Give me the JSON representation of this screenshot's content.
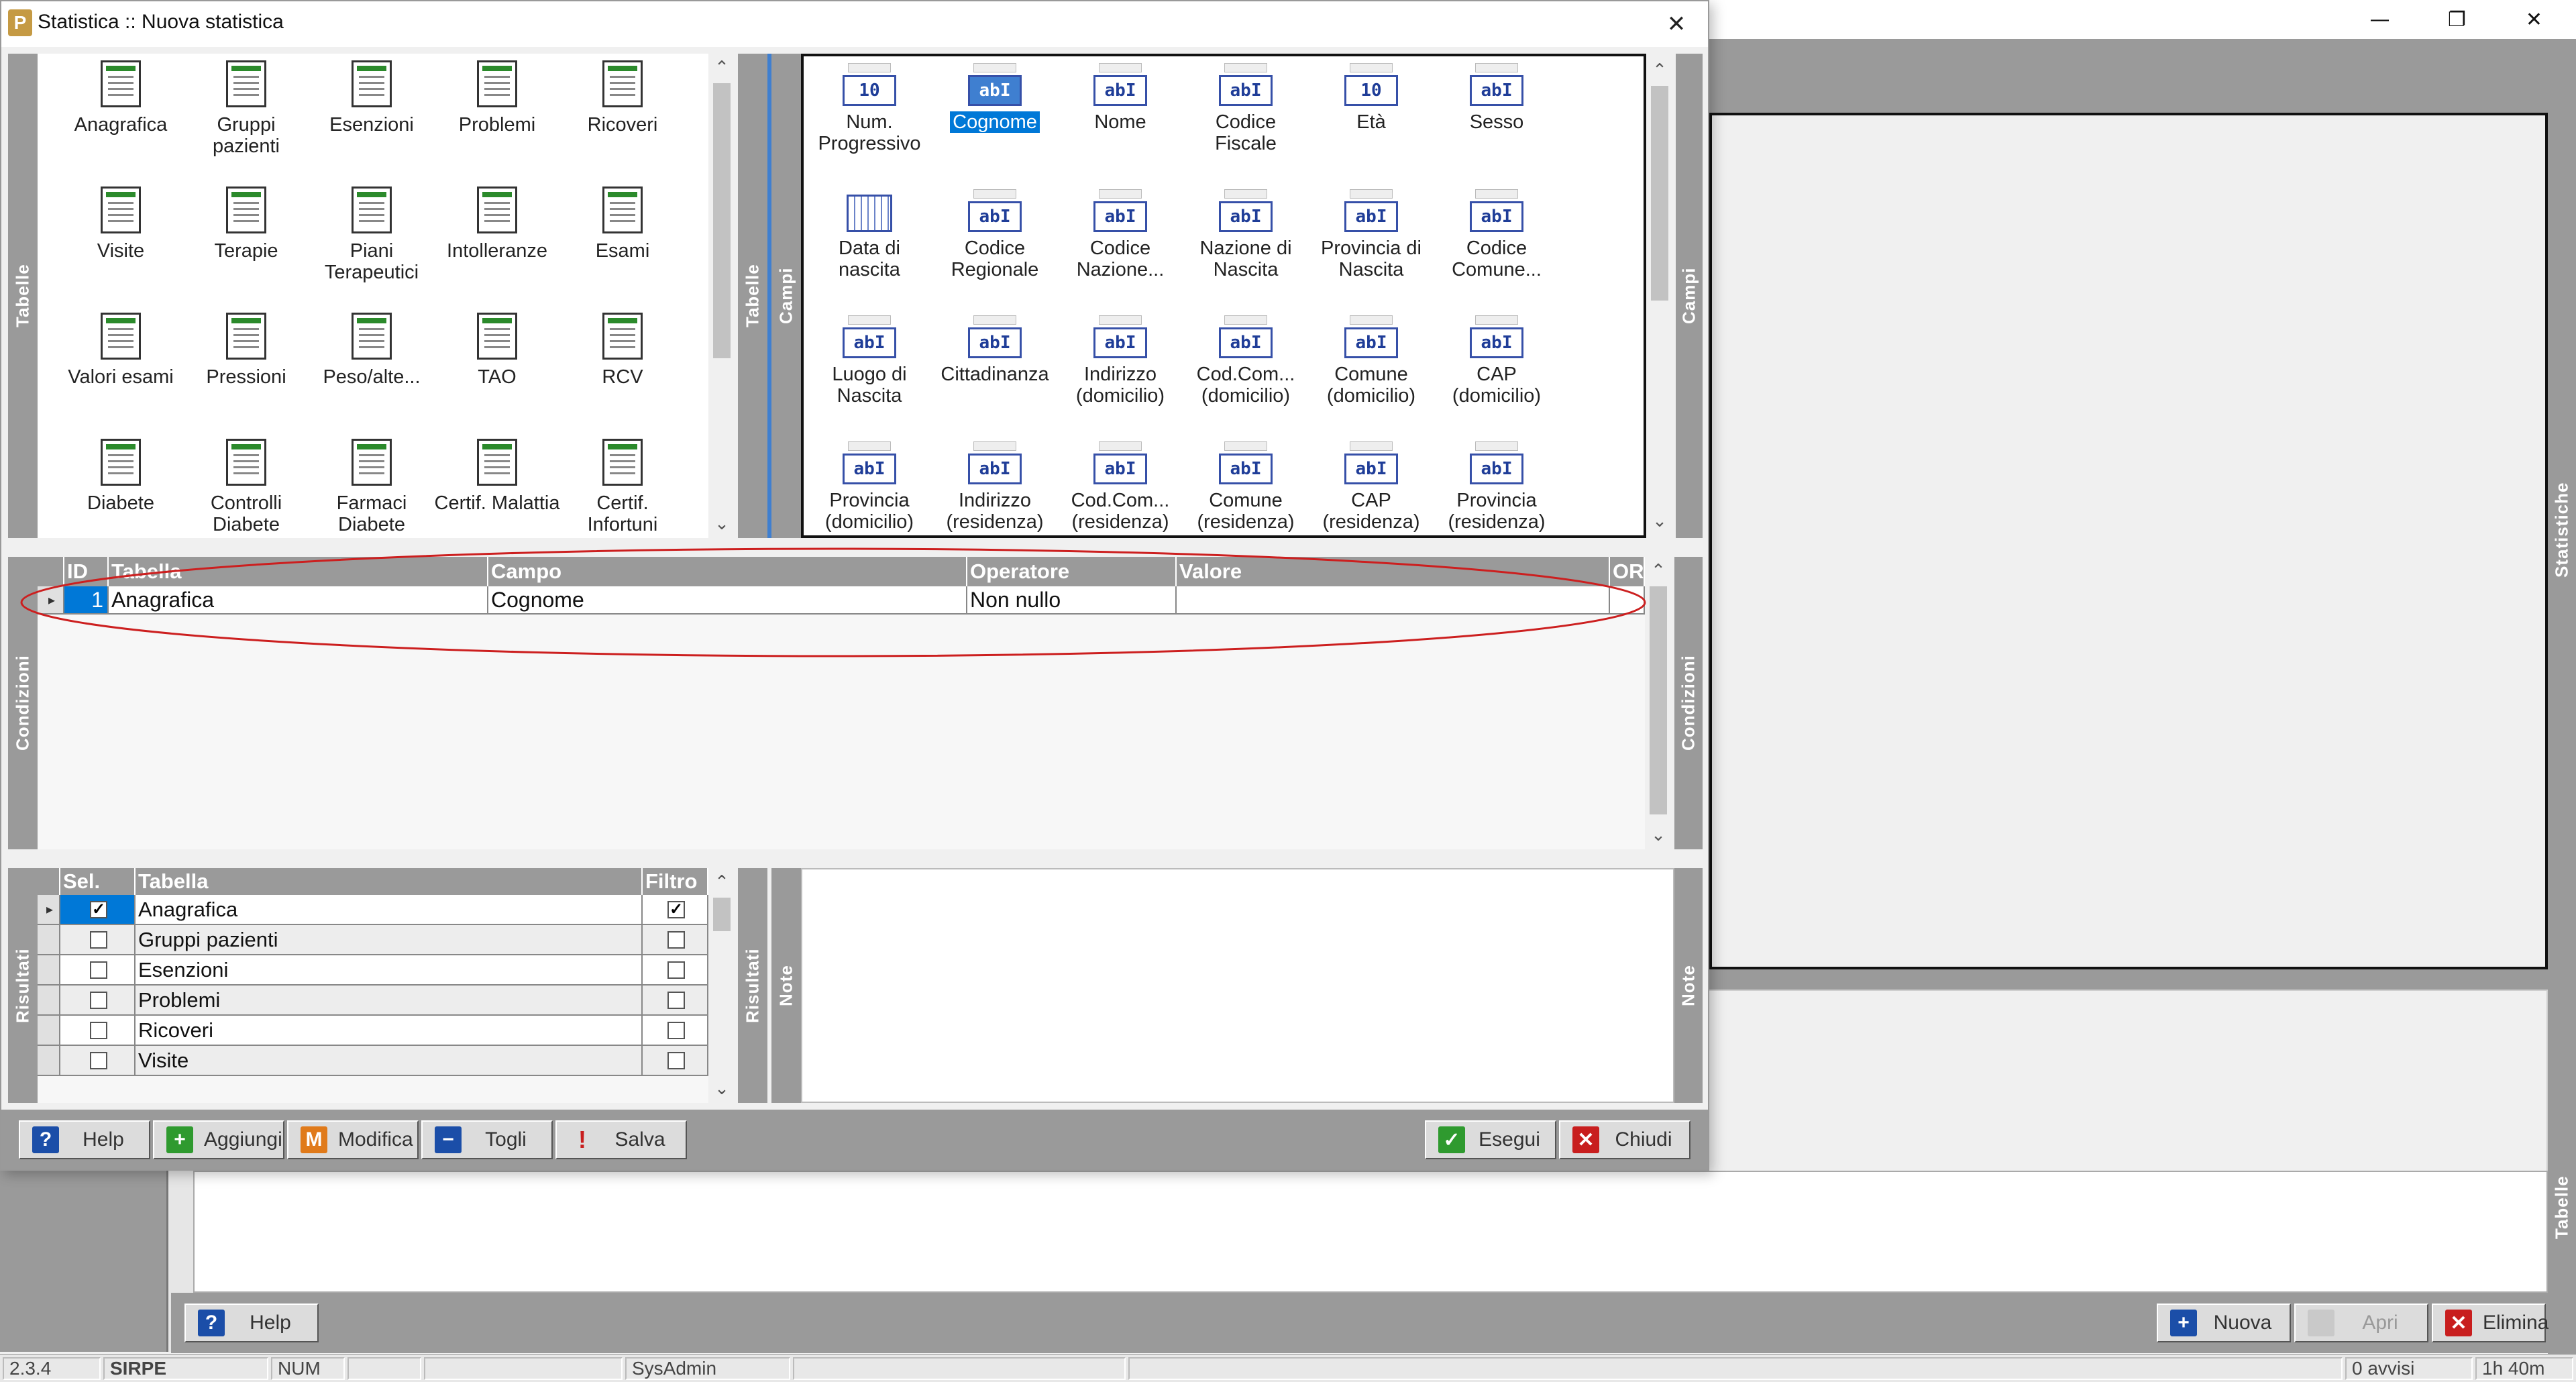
{
  "dialog": {
    "title": "Statistica :: Nuova statistica",
    "app_icon": "P",
    "close": "✕"
  },
  "bg_window": {
    "min": "—",
    "restore": "❐",
    "close": "✕"
  },
  "labels": {
    "tabelle": "Tabelle",
    "campi": "Campi",
    "condizioni": "Condizioni",
    "risultati": "Risultati",
    "note": "Note",
    "statistiche": "Statistiche"
  },
  "tables": [
    "Anagrafica",
    "Gruppi pazienti",
    "Esenzioni",
    "Problemi",
    "Ricoveri",
    "Visite",
    "Terapie",
    "Piani Terapeutici",
    "Intolleranze",
    "Esami",
    "Valori esami",
    "Pressioni",
    "Peso/alte...",
    "TAO",
    "RCV",
    "Diabete",
    "Controlli Diabete",
    "Farmaci Diabete",
    "Certif. Malattia",
    "Certif. Infortuni"
  ],
  "fields": [
    {
      "label": "Num. Progressivo",
      "icon": "10"
    },
    {
      "label": "Cognome",
      "icon": "abI",
      "selected": true
    },
    {
      "label": "Nome",
      "icon": "abI"
    },
    {
      "label": "Codice Fiscale",
      "icon": "abI"
    },
    {
      "label": "Età",
      "icon": "10"
    },
    {
      "label": "Sesso",
      "icon": "abI"
    },
    {
      "label": "Data di nascita",
      "icon": "cal"
    },
    {
      "label": "Codice Regionale",
      "icon": "abI"
    },
    {
      "label": "Codice Nazione...",
      "icon": "abI"
    },
    {
      "label": "Nazione di Nascita",
      "icon": "abI"
    },
    {
      "label": "Provincia di Nascita",
      "icon": "abI"
    },
    {
      "label": "Codice Comune...",
      "icon": "abI"
    },
    {
      "label": "Luogo di Nascita",
      "icon": "abI"
    },
    {
      "label": "Cittadinanza",
      "icon": "abI"
    },
    {
      "label": "Indirizzo (domicilio)",
      "icon": "abI"
    },
    {
      "label": "Cod.Com... (domicilio)",
      "icon": "abI"
    },
    {
      "label": "Comune (domicilio)",
      "icon": "abI"
    },
    {
      "label": "CAP (domicilio)",
      "icon": "abI"
    },
    {
      "label": "Provincia (domicilio)",
      "icon": "abI"
    },
    {
      "label": "Indirizzo (residenza)",
      "icon": "abI"
    },
    {
      "label": "Cod.Com... (residenza)",
      "icon": "abI"
    },
    {
      "label": "Comune (residenza)",
      "icon": "abI"
    },
    {
      "label": "CAP (residenza)",
      "icon": "abI"
    },
    {
      "label": "Provincia (residenza)",
      "icon": "abI"
    }
  ],
  "conditions": {
    "columns": [
      "ID",
      "Tabella",
      "Campo",
      "Operatore",
      "Valore",
      "OR"
    ],
    "rows": [
      {
        "id": "1",
        "tabella": "Anagrafica",
        "campo": "Cognome",
        "operatore": "Non nullo",
        "valore": "",
        "or": ""
      }
    ]
  },
  "results": {
    "columns": [
      "Sel.",
      "Tabella",
      "Filtro"
    ],
    "rows": [
      {
        "sel": true,
        "tabella": "Anagrafica",
        "filtro": true
      },
      {
        "sel": false,
        "tabella": "Gruppi pazienti",
        "filtro": false
      },
      {
        "sel": false,
        "tabella": "Esenzioni",
        "filtro": false
      },
      {
        "sel": false,
        "tabella": "Problemi",
        "filtro": false
      },
      {
        "sel": false,
        "tabella": "Ricoveri",
        "filtro": false
      },
      {
        "sel": false,
        "tabella": "Visite",
        "filtro": false
      }
    ]
  },
  "dialog_buttons": {
    "help": "Help",
    "aggiungi": "Aggiungi",
    "modifica": "Modifica",
    "togli": "Togli",
    "salva": "Salva",
    "esegui": "Esegui",
    "chiudi": "Chiudi"
  },
  "main_buttons": {
    "help": "Help",
    "nuova": "Nuova",
    "apri": "Apri",
    "elimina": "Elimina"
  },
  "status": {
    "version": "2.3.4",
    "app": "SIRPE",
    "num": "NUM",
    "user": "SysAdmin",
    "avvisi": "0 avvisi",
    "time": "1h 40m"
  },
  "colors": {
    "accent": "#0078d7",
    "annotation": "#cc1f1f",
    "panel_dark": "#9a9a9a"
  }
}
